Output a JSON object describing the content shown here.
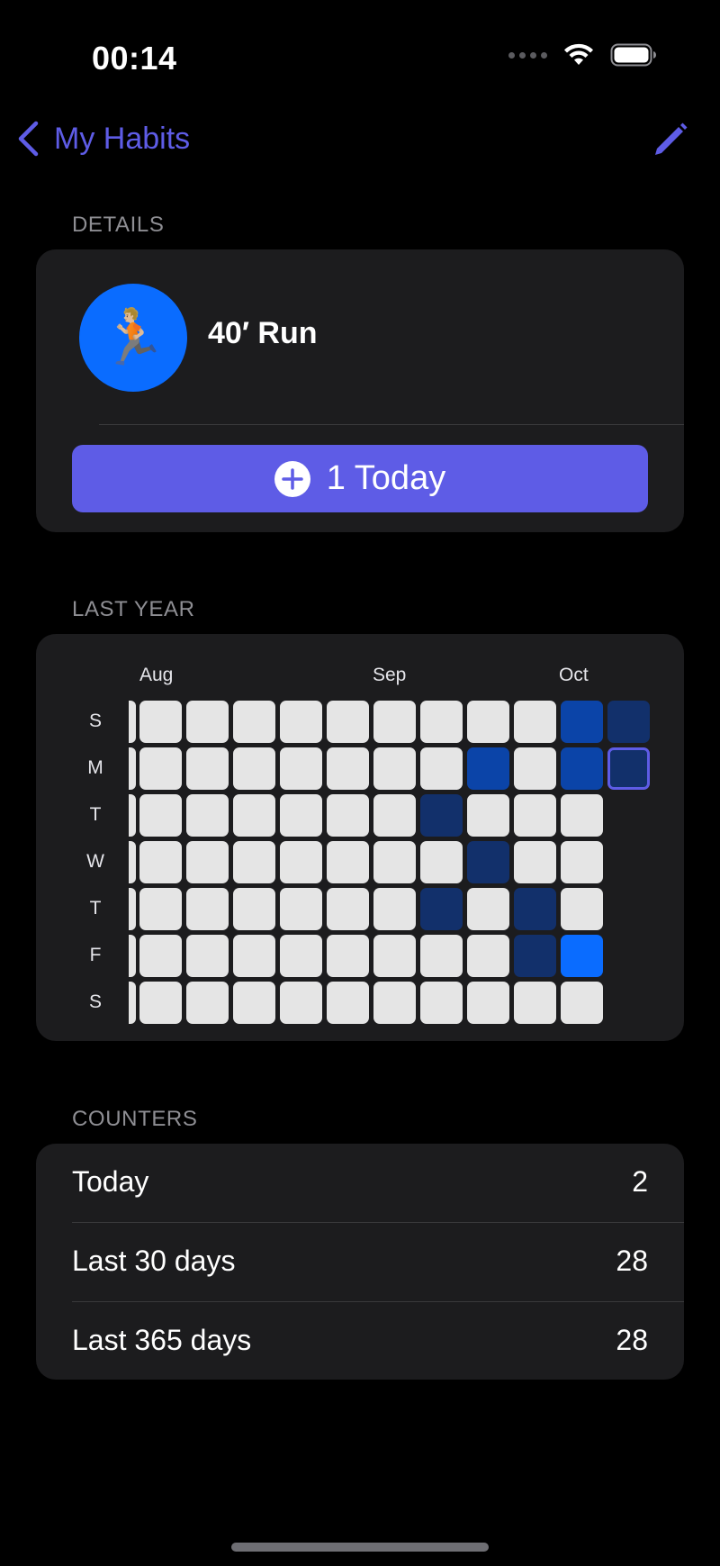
{
  "status_bar": {
    "time": "00:14"
  },
  "nav": {
    "back_label": "My Habits",
    "edit_icon": "pencil-icon"
  },
  "details": {
    "header": "DETAILS",
    "habit_name": "40′ Run",
    "habit_emoji": "🏃🏼",
    "icon_color": "#0A6CFF",
    "today_button_label": "1 Today"
  },
  "last_year": {
    "header": "LAST YEAR",
    "months": [
      "Aug",
      "Sep",
      "Oct"
    ],
    "day_labels": [
      "S",
      "M",
      "T",
      "W",
      "T",
      "F",
      "S"
    ],
    "legend_colors": {
      "empty": "#E5E5E5",
      "dark": "#12306B",
      "medium": "#0B44A8",
      "bright": "#0A6CFF",
      "today_border": "#5E5CE6"
    },
    "grid_levels_by_week": [
      [
        0,
        0,
        0,
        0,
        0,
        0,
        0
      ],
      [
        0,
        0,
        0,
        0,
        0,
        0,
        0
      ],
      [
        0,
        0,
        0,
        0,
        0,
        0,
        0
      ],
      [
        0,
        0,
        0,
        0,
        0,
        0,
        0
      ],
      [
        0,
        0,
        0,
        0,
        0,
        0,
        0
      ],
      [
        0,
        0,
        0,
        0,
        0,
        0,
        0
      ],
      [
        0,
        0,
        1,
        0,
        1,
        0,
        0
      ],
      [
        0,
        2,
        0,
        1,
        0,
        0,
        0
      ],
      [
        0,
        0,
        0,
        0,
        1,
        1,
        0
      ],
      [
        2,
        2,
        0,
        0,
        0,
        3,
        0
      ],
      [
        1,
        1,
        null,
        null,
        null,
        null,
        null
      ]
    ],
    "today_position": {
      "week": 10,
      "day": 1
    }
  },
  "counters": {
    "header": "COUNTERS",
    "rows": [
      {
        "label": "Today",
        "value": "2"
      },
      {
        "label": "Last 30 days",
        "value": "28"
      },
      {
        "label": "Last 365 days",
        "value": "28"
      }
    ]
  }
}
